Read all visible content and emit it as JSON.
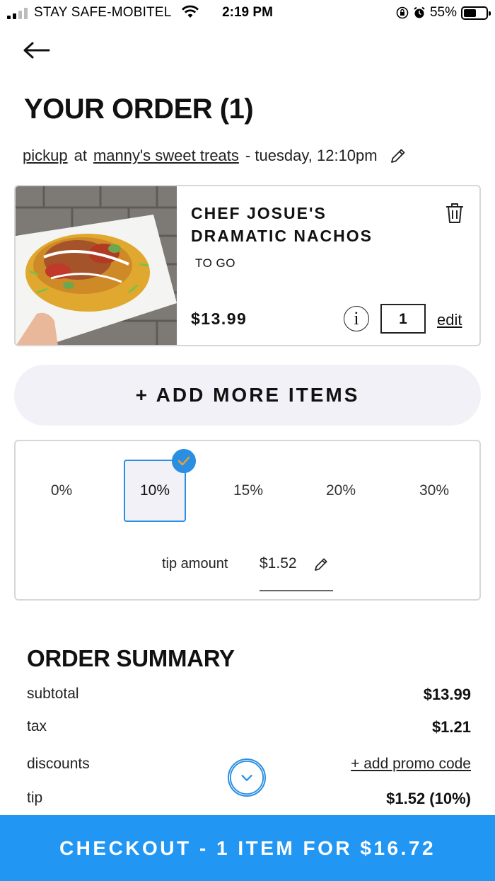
{
  "status_bar": {
    "carrier": "STAY SAFE-MOBITEL",
    "time": "2:19 PM",
    "battery": "55%",
    "battery_level": 0.55
  },
  "header": {
    "title": "YOUR ORDER (1)"
  },
  "order_meta": {
    "mode": "pickup",
    "at": "at",
    "store": "manny's sweet treats",
    "when": "- tuesday, 12:10pm"
  },
  "item": {
    "name": "CHEF JOSUE'S DRAMATIC NACHOS",
    "option": "TO GO",
    "price": "$13.99",
    "info": "i",
    "quantity": "1",
    "edit_label": "edit"
  },
  "add_more": {
    "label": "+ ADD MORE ITEMS"
  },
  "tip": {
    "options": [
      "0%",
      "10%",
      "15%",
      "20%",
      "30%"
    ],
    "selected": "10%",
    "amount_label": "tip amount",
    "amount_value": "$1.52"
  },
  "summary": {
    "title": "ORDER SUMMARY",
    "subtotal_label": "subtotal",
    "subtotal_value": "$13.99",
    "tax_label": "tax",
    "tax_value": "$1.21",
    "discounts_label": "discounts",
    "promo_label": "+ add promo code",
    "tip_label": "tip",
    "tip_value": "$1.52 (10%)"
  },
  "checkout": {
    "label": "CHECKOUT - 1 ITEM FOR $16.72"
  },
  "colors": {
    "accent": "#2196f3",
    "selected_border": "#2a8fe3",
    "pill_bg": "#f2f1f7"
  }
}
